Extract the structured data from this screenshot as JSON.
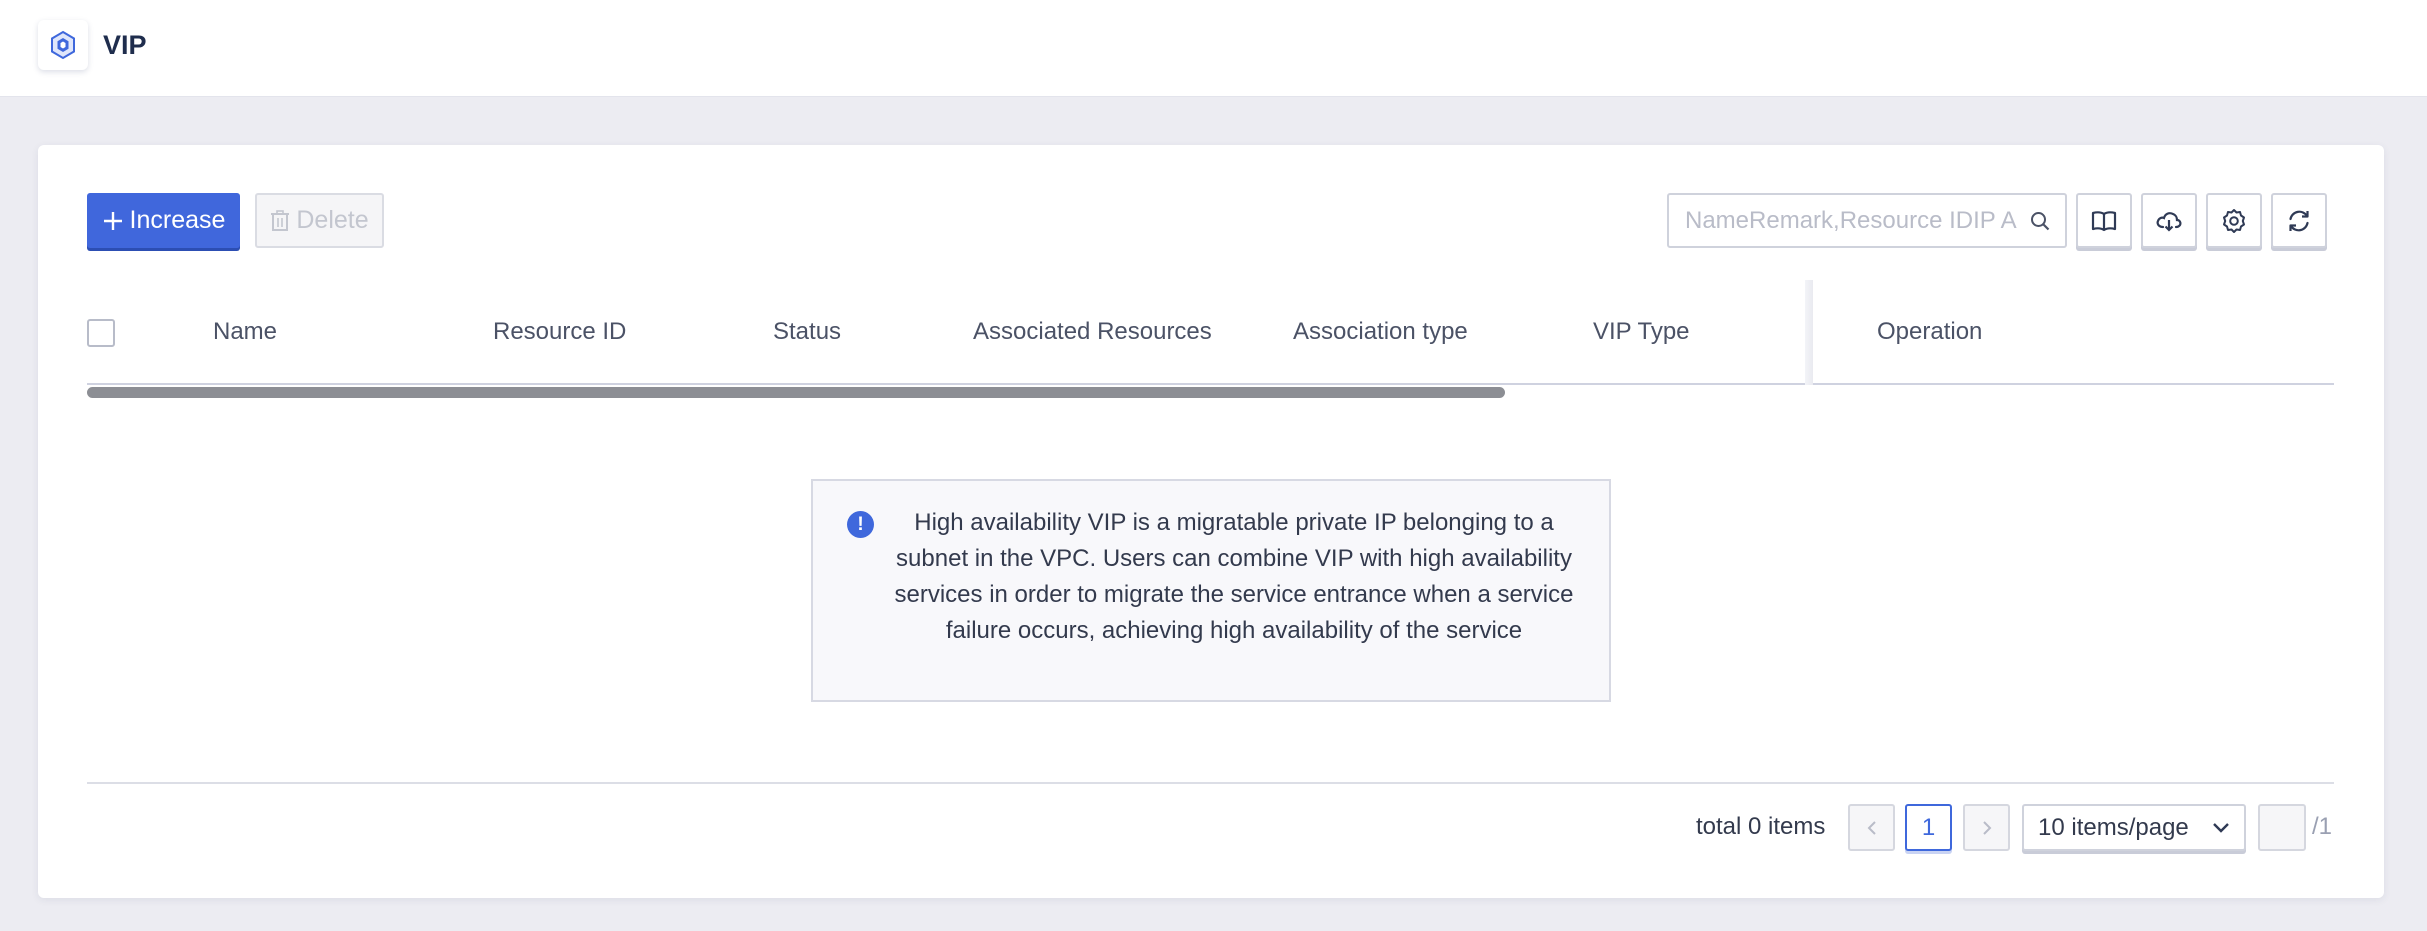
{
  "header": {
    "title": "VIP"
  },
  "toolbar": {
    "increase_label": "Increase",
    "delete_label": "Delete",
    "search_placeholder": "NameRemark,Resource IDIP A"
  },
  "table": {
    "columns": [
      "Name",
      "Resource ID",
      "Status",
      "Associated Resources",
      "Association type",
      "VIP Type",
      "Operation"
    ]
  },
  "empty_info": {
    "text": "High availability VIP is a migratable private IP belonging to a subnet in the VPC. Users can combine VIP with high availability services in order to migrate the service entrance when a service failure occurs, achieving high availability of the service"
  },
  "pagination": {
    "total_text": "total 0 items",
    "current_page": "1",
    "page_size": "10 items/page",
    "total_pages": "/1"
  },
  "colors": {
    "primary": "#4067dc",
    "background": "#ececf2"
  },
  "icons": [
    "vip-logo-icon",
    "plus-icon",
    "trash-icon",
    "search-icon",
    "book-icon",
    "cloud-download-icon",
    "gear-icon",
    "refresh-icon",
    "info-icon",
    "chevron-left-icon",
    "chevron-right-icon",
    "chevron-down-icon"
  ]
}
